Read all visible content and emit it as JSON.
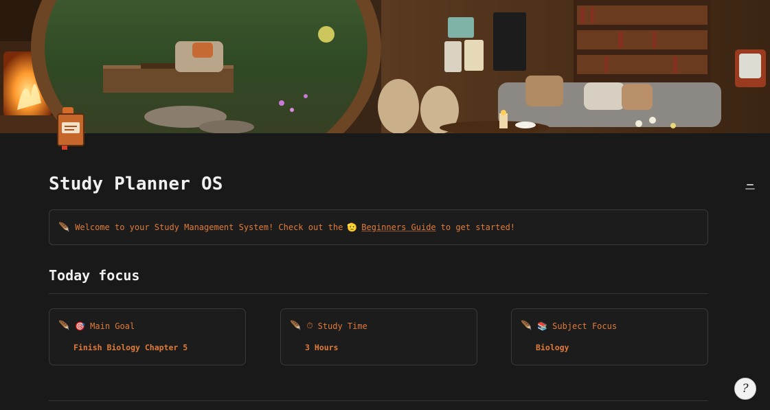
{
  "page": {
    "title": "Study Planner OS",
    "icon": "notebook-icon"
  },
  "cover": {
    "description_icon": "cozy-cabin-cover-image"
  },
  "callout": {
    "icon": "🪶",
    "text_before": "Welcome to your Study Management System! Check out the",
    "link_icon": "🫡",
    "link_text": "Beginners Guide",
    "text_after": "to get started!"
  },
  "section": {
    "title": "Today focus"
  },
  "cards": [
    {
      "pin": "🪶",
      "icon": "🎯",
      "label": "Main Goal",
      "value": "Finish Biology Chapter 5"
    },
    {
      "pin": "🪶",
      "icon": "⏱",
      "label": "Study Time",
      "value": "3 Hours"
    },
    {
      "pin": "🪶",
      "icon": "📚",
      "label": "Subject Focus",
      "value": "Biology"
    }
  ],
  "help": {
    "label": "?"
  },
  "colors": {
    "accent": "#e07b39",
    "background": "#191919",
    "border": "#3a3a3a"
  }
}
